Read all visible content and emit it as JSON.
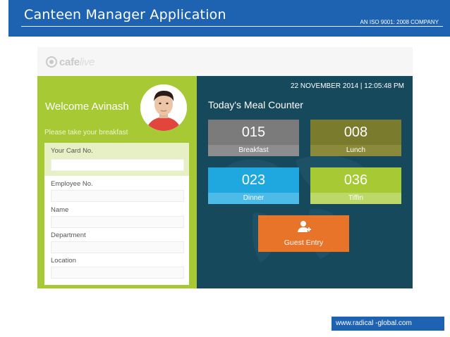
{
  "slide": {
    "title": "Canteen Manager Application",
    "iso_note": "AN ISO 9001: 2008 COMPANY",
    "footer_url": "www.radical -global.com"
  },
  "app": {
    "logo": {
      "part1": "cafe",
      "part2": "live"
    },
    "left": {
      "welcome": "Welcome Avinash",
      "prompt": "Please take your breakfast",
      "fields": [
        {
          "label": "Your Card No.",
          "value": ""
        },
        {
          "label": "Employee No.",
          "value": ""
        },
        {
          "label": "Name",
          "value": ""
        },
        {
          "label": "Department",
          "value": ""
        },
        {
          "label": "Location",
          "value": ""
        }
      ]
    },
    "right": {
      "datetime": "22 NOVEMBER 2014  | 12:05:48 PM",
      "counter_title": "Today's Meal Counter",
      "tiles": [
        {
          "label": "Breakfast",
          "count": "015"
        },
        {
          "label": "Lunch",
          "count": "008"
        },
        {
          "label": "Dinner",
          "count": "023"
        },
        {
          "label": "Tiffin",
          "count": "036"
        }
      ],
      "guest_button": {
        "label": "Guest Entry",
        "icon": "add-user-icon"
      }
    }
  },
  "colors": {
    "header_blue": "#1e63b2",
    "green": "#a6c934",
    "dark_teal": "#17495c",
    "orange": "#e8742a",
    "cyan": "#1fa8e0"
  }
}
